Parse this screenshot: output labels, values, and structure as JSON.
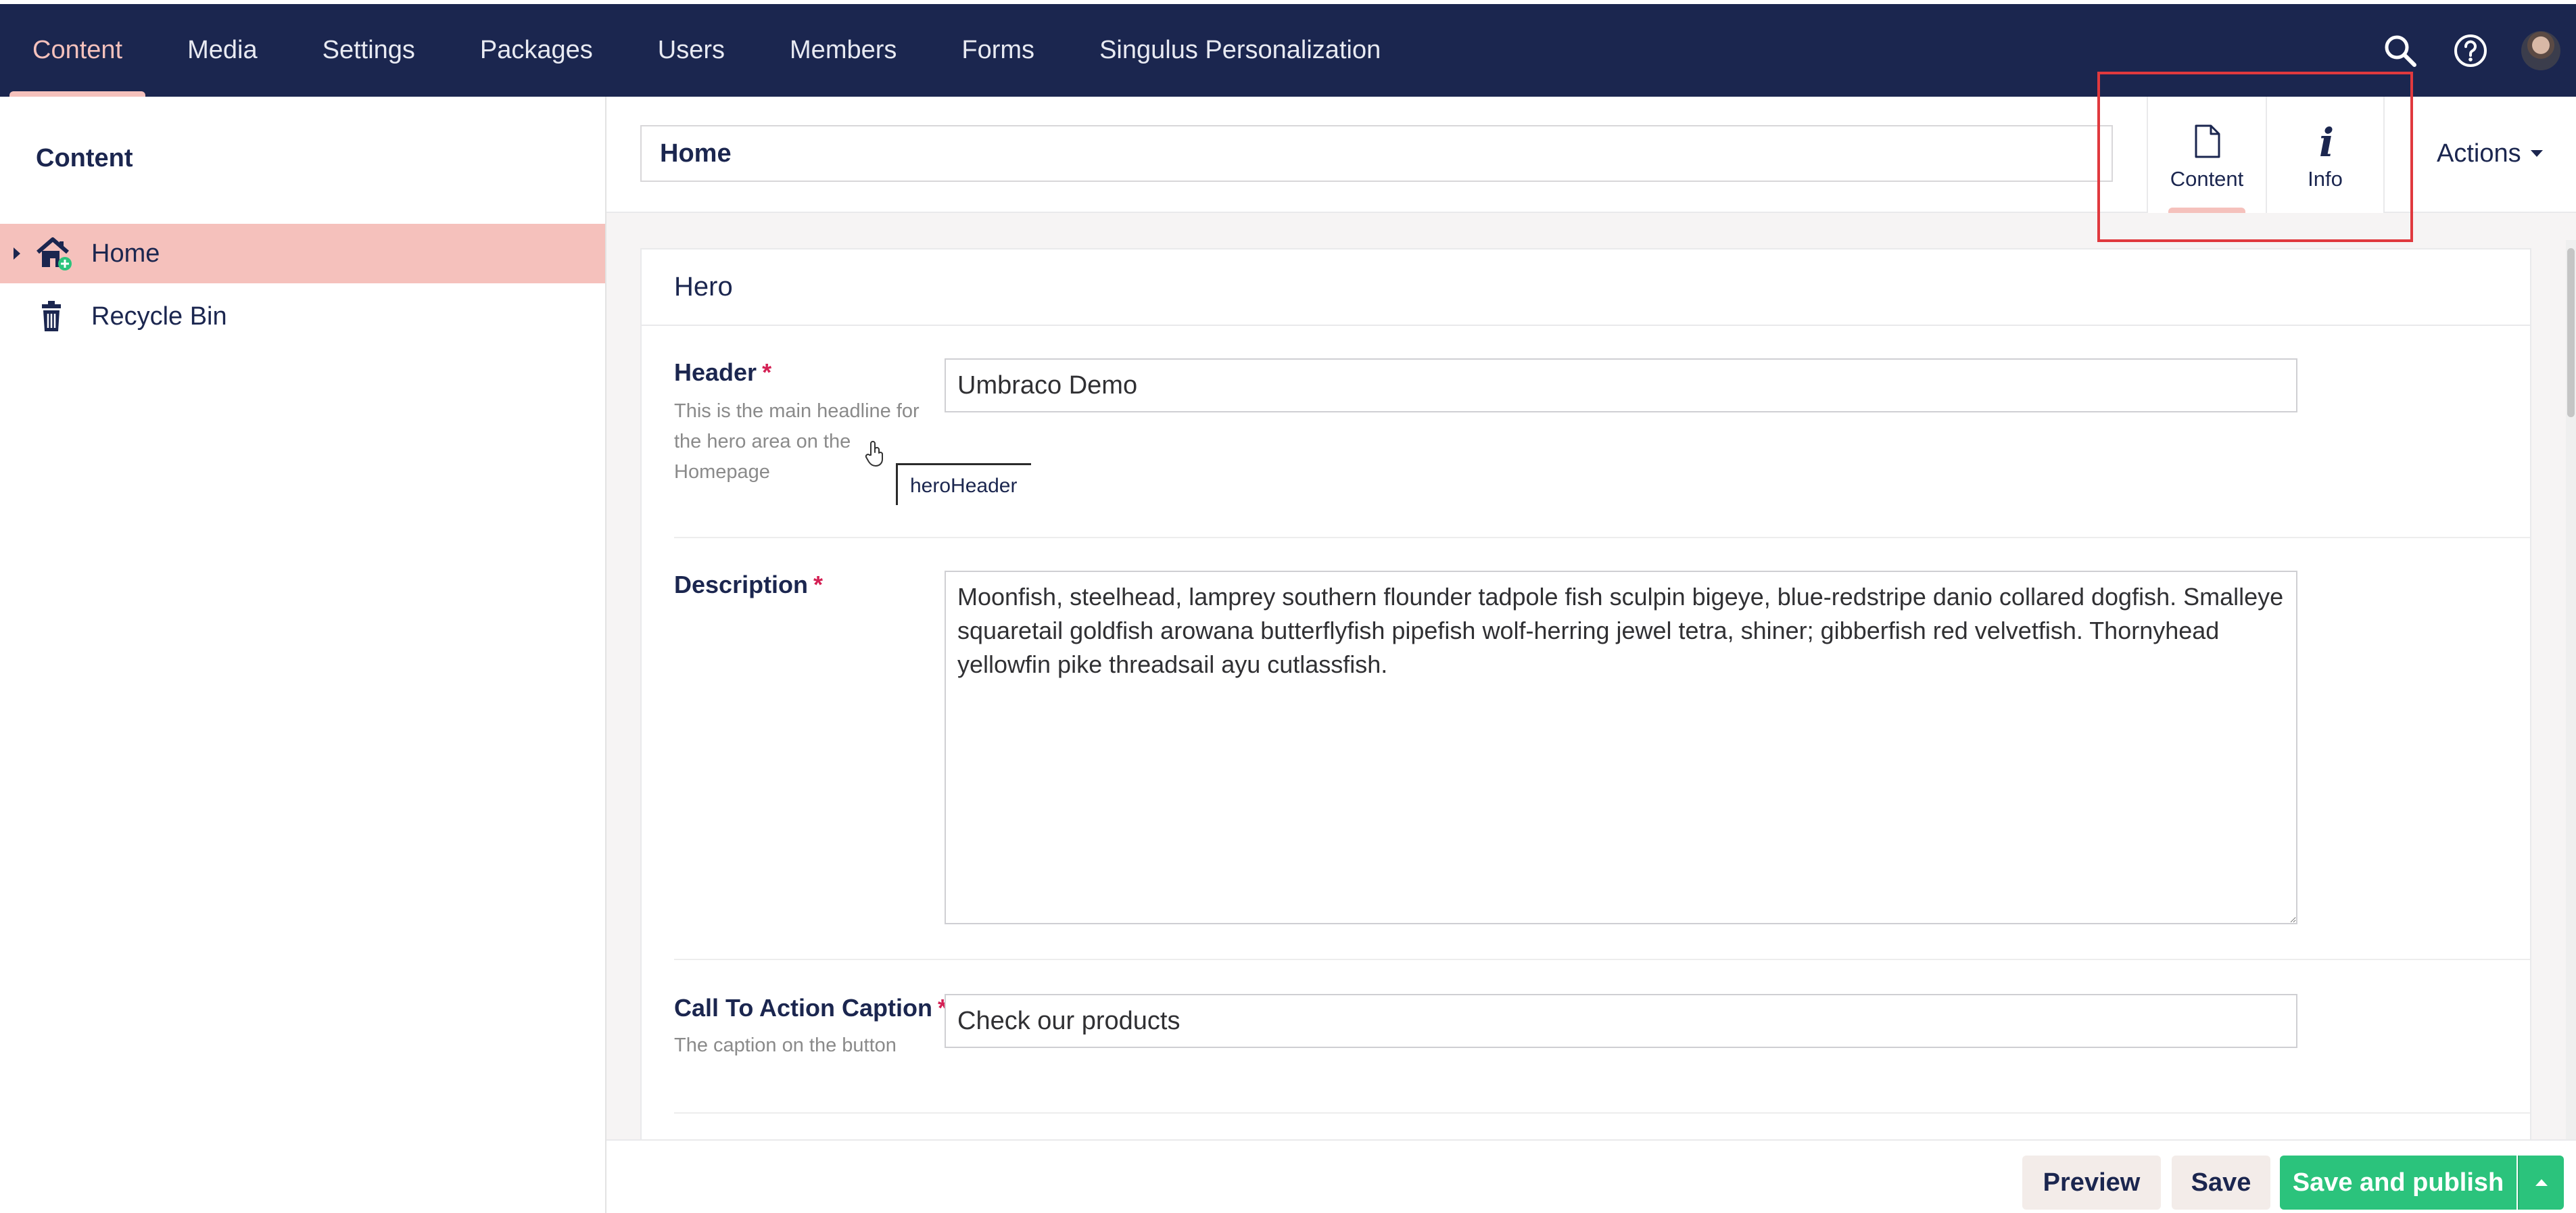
{
  "sections": [
    {
      "label": "Content",
      "active": true
    },
    {
      "label": "Media",
      "active": false
    },
    {
      "label": "Settings",
      "active": false
    },
    {
      "label": "Packages",
      "active": false
    },
    {
      "label": "Users",
      "active": false
    },
    {
      "label": "Members",
      "active": false
    },
    {
      "label": "Forms",
      "active": false
    },
    {
      "label": "Singulus Personalization",
      "active": false
    }
  ],
  "header_tools": [
    {
      "icon": "search-icon"
    },
    {
      "icon": "help-icon"
    },
    {
      "icon": "user-avatar"
    }
  ],
  "tree": {
    "title": "Content",
    "items": [
      {
        "label": "Home",
        "icon": "home-icon",
        "selected": true
      },
      {
        "label": "Recycle Bin",
        "icon": "trash-icon",
        "selected": false
      }
    ]
  },
  "editor": {
    "node_name": "Home",
    "apps": [
      {
        "label": "Content",
        "icon": "document-icon",
        "active": true
      },
      {
        "label": "Info",
        "icon": "info-icon",
        "active": false
      }
    ],
    "actions_label": "Actions"
  },
  "group": {
    "title": "Hero",
    "properties": {
      "header": {
        "label": "Header",
        "required_mark": "*",
        "description": "This is the main headline for the hero area on the Homepage",
        "alias_tooltip": "heroHeader",
        "value": "Umbraco Demo"
      },
      "description": {
        "label": "Description",
        "required_mark": "*",
        "value": "Moonfish, steelhead, lamprey southern flounder tadpole fish sculpin bigeye, blue-redstripe danio collared dogfish. Smalleye squaretail goldfish arowana butterflyfish pipefish wolf-herring jewel tetra, shiner; gibberfish red velvetfish. Thornyhead yellowfin pike threadsail ayu cutlassfish."
      },
      "cta_caption": {
        "label": "Call To Action Caption",
        "required_mark": "*",
        "description": "The caption on the button",
        "value": "Check our products"
      }
    }
  },
  "footer": {
    "preview_label": "Preview",
    "save_label": "Save",
    "publish_label": "Save and publish"
  },
  "colors": {
    "nav_bg": "#1b264f",
    "accent_pink": "#f5c1bc",
    "publish_green": "#2bc37c",
    "annotation_red": "#e0393e",
    "required_red": "#d42054"
  }
}
